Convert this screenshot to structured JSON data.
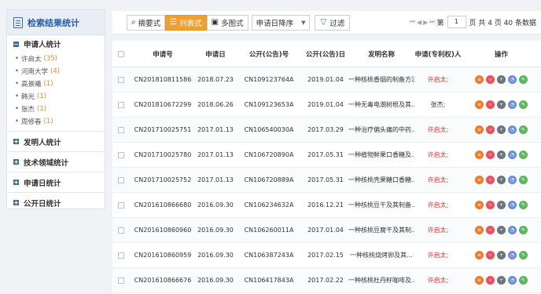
{
  "sidebar": {
    "title": "检索结果统计",
    "applicant_section": "申请人统计",
    "applicants": [
      {
        "name": "许启太",
        "count": "(35)"
      },
      {
        "name": "河南大学",
        "count": "(4)"
      },
      {
        "name": "高景曦",
        "count": "(1)"
      },
      {
        "name": "韩光",
        "count": "(1)"
      },
      {
        "name": "张杰",
        "count": "(1)"
      },
      {
        "name": "周修春",
        "count": "(1)"
      }
    ],
    "sections": [
      "发明人统计",
      "技术领域统计",
      "申请日统计",
      "公开日统计"
    ]
  },
  "toolbar": {
    "btn_summary": "摘要式",
    "btn_list": "列表式",
    "btn_image": "多图式",
    "sort_label": "申请日降序",
    "filter_label": "过滤",
    "page_prefix": "第",
    "page_value": "1",
    "page_suffix": "页 共 4 页 40 条数据"
  },
  "table": {
    "headers": {
      "app_no": "申请号",
      "app_date": "申请日",
      "pub_no": "公开(公告)号",
      "pub_date": "公开(公告)日",
      "title": "发明名称",
      "holder": "申请(专利权)人",
      "ops": "操作"
    },
    "rows": [
      {
        "app_no": "CN201810811586",
        "app_date": "2018.07.23",
        "pub_no": "CN109123764A",
        "pub_date": "2019.01.04",
        "title": "一种核桃香烟的制备方法",
        "holder": "许启太;",
        "red": true
      },
      {
        "app_no": "CN201810672299",
        "app_date": "2018.06.26",
        "pub_no": "CN109123653A",
        "pub_date": "2019.01.04",
        "title": "一种无毒电潮树根及其...",
        "holder": "张杰;",
        "red": false
      },
      {
        "app_no": "CN201710025751",
        "app_date": "2017.01.13",
        "pub_no": "CN106540030A",
        "pub_date": "2017.03.29",
        "title": "一种治疗偏头痛的中药...",
        "holder": "许启太;",
        "red": true
      },
      {
        "app_no": "CN201710025780",
        "app_date": "2017.01.13",
        "pub_no": "CN106720890A",
        "pub_date": "2017.05.31",
        "title": "一种植物鲜果口香糖及...",
        "holder": "许启太;",
        "red": true
      },
      {
        "app_no": "CN201710025752",
        "app_date": "2017.01.13",
        "pub_no": "CN106720889A",
        "pub_date": "2017.05.31",
        "title": "一种核桃壳果糖口香糖...",
        "holder": "许启太;",
        "red": true
      },
      {
        "app_no": "CN201610866680",
        "app_date": "2016.09.30",
        "pub_no": "CN106234632A",
        "pub_date": "2016.12.21",
        "title": "一种核桃豆干及其制备...",
        "holder": "许启太;",
        "red": true
      },
      {
        "app_no": "CN201610860960",
        "app_date": "2016.09.30",
        "pub_no": "CN106260011A",
        "pub_date": "2017.01.04",
        "title": "一种核桃豆腐干及其制...",
        "holder": "许启太;",
        "red": true
      },
      {
        "app_no": "CN201610860959",
        "app_date": "2016.09.30",
        "pub_no": "CN106387243A",
        "pub_date": "2017.02.15",
        "title": "一种核桃烧烤卵及其...",
        "holder": "许启太;",
        "red": true
      },
      {
        "app_no": "CN201610866676",
        "app_date": "2016.09.30",
        "pub_no": "CN106417843A",
        "pub_date": "2017.02.22",
        "title": "一种核桃杜丹籽咖啡及...",
        "holder": "许启太;",
        "red": true
      }
    ]
  },
  "colors": {
    "accent_blue": "#3a6bb5",
    "active_orange": "#f0a030",
    "holder_red": "#e03030"
  }
}
